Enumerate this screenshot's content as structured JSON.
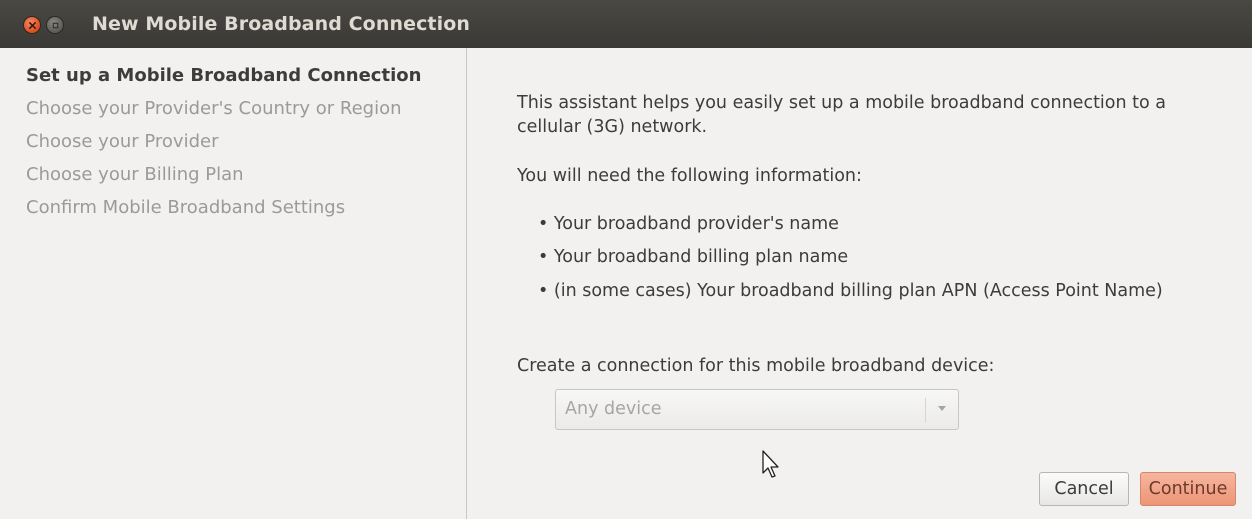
{
  "window": {
    "title": "New Mobile Broadband Connection"
  },
  "sidebar": {
    "steps": [
      {
        "label": "Set up a Mobile Broadband Connection",
        "active": true
      },
      {
        "label": "Choose your Provider's Country or Region",
        "active": false
      },
      {
        "label": "Choose your Provider",
        "active": false
      },
      {
        "label": "Choose your Billing Plan",
        "active": false
      },
      {
        "label": "Confirm Mobile Broadband Settings",
        "active": false
      }
    ]
  },
  "main": {
    "intro_line1": "This assistant helps you easily set up a mobile broadband connection to a",
    "intro_line2": "cellular (3G) network.",
    "need_info": "You will need the following information:",
    "bullets": [
      "• Your broadband provider's name",
      "• Your broadband billing plan name",
      "• (in some cases) Your broadband billing plan APN (Access Point Name)"
    ],
    "device_label": "Create a connection for this mobile broadband device:",
    "device_select": {
      "value": "Any device"
    }
  },
  "buttons": {
    "cancel": "Cancel",
    "continue": "Continue"
  },
  "icons": {
    "close": "close-icon",
    "minimize": "minimize-icon",
    "dropdown": "chevron-down-icon",
    "cursor": "mouse-pointer-icon"
  },
  "colors": {
    "titlebar": "#3c3b37",
    "close_button": "#e35d2f",
    "continue_button": "#f0a389"
  }
}
